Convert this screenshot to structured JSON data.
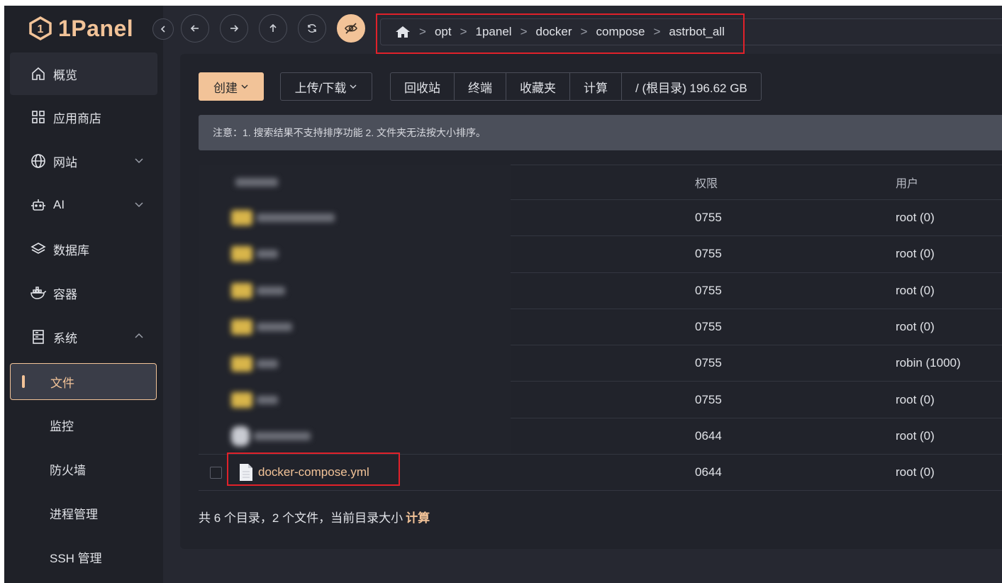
{
  "app": {
    "logo_text": "1Panel"
  },
  "sidebar": {
    "items": [
      {
        "label": "概览",
        "icon": "home-icon"
      },
      {
        "label": "应用商店",
        "icon": "apps-grid-icon"
      },
      {
        "label": "网站",
        "icon": "globe-icon",
        "expandable": true
      },
      {
        "label": "AI",
        "icon": "robot-icon",
        "expandable": true
      },
      {
        "label": "数据库",
        "icon": "layers-icon"
      },
      {
        "label": "容器",
        "icon": "docker-icon"
      },
      {
        "label": "系统",
        "icon": "server-icon",
        "expanded": true
      }
    ],
    "sub_items": [
      {
        "label": "文件",
        "active": true
      },
      {
        "label": "监控"
      },
      {
        "label": "防火墙"
      },
      {
        "label": "进程管理"
      },
      {
        "label": "SSH 管理"
      }
    ]
  },
  "breadcrumb": [
    "opt",
    "1panel",
    "docker",
    "compose",
    "astrbot_all"
  ],
  "toolbar": {
    "create_label": "创建",
    "upload_label": "上传/下载",
    "group": [
      "回收站",
      "终端",
      "收藏夹",
      "计算",
      "/ (根目录) 196.62 GB"
    ]
  },
  "notice": "注意：1. 搜索结果不支持排序功能 2. 文件夹无法按大小排序。",
  "table": {
    "headers": {
      "permission": "权限",
      "user": "用户"
    },
    "rows": [
      {
        "type": "folder",
        "permission": "0755",
        "user": "root (0)"
      },
      {
        "type": "folder",
        "permission": "0755",
        "user": "root (0)"
      },
      {
        "type": "folder",
        "permission": "0755",
        "user": "root (0)"
      },
      {
        "type": "folder",
        "permission": "0755",
        "user": "root (0)"
      },
      {
        "type": "folder",
        "permission": "0755",
        "user": "robin (1000)"
      },
      {
        "type": "folder",
        "permission": "0755",
        "user": "root (0)"
      },
      {
        "type": "file",
        "permission": "0644",
        "user": "root (0)"
      },
      {
        "type": "file",
        "name": "docker-compose.yml",
        "permission": "0644",
        "user": "root (0)"
      }
    ]
  },
  "footer": {
    "text": "共 6 个目录，2 个文件，当前目录大小",
    "link": "计算"
  },
  "colors": {
    "accent": "#f2c398",
    "highlight_box": "#e0212a"
  }
}
